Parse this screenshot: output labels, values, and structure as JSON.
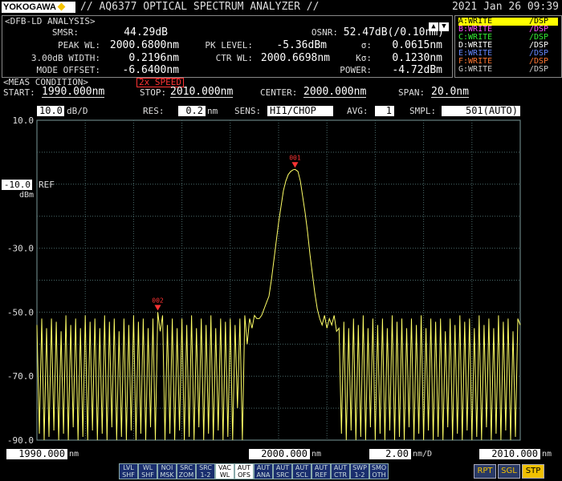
{
  "header": {
    "logo": "YOKOGAWA",
    "title": "// AQ6377 OPTICAL SPECTRUM ANALYZER //",
    "datetime": "2021 Jan 26 09:39"
  },
  "analysis": {
    "title": "<DFB-LD ANALYSIS>",
    "left": [
      {
        "label": "SMSR:",
        "value": "44.29dB"
      },
      {
        "label": "PEAK WL:",
        "value": "2000.6800nm"
      },
      {
        "label": "3.00dB WIDTH:",
        "value": "0.2196nm"
      },
      {
        "label": "MODE OFFSET:",
        "value": "-6.6400nm"
      }
    ],
    "mid": [
      {
        "label": "PK LEVEL:",
        "value": "-5.36dBm"
      },
      {
        "label": "CTR WL:",
        "value": "2000.6698nm"
      }
    ],
    "right": [
      {
        "label": "OSNR:",
        "value": "52.47dB(/0.10nm)"
      },
      {
        "label": "σ:",
        "value": "0.0615nm"
      },
      {
        "label": "Kσ:",
        "value": "0.1230nm"
      },
      {
        "label": "POWER:",
        "value": "-4.72dBm"
      }
    ]
  },
  "traces": [
    {
      "name": "A:WRITE",
      "mode": "/DSP",
      "color": "#ffff00",
      "selected": true
    },
    {
      "name": "B:WRITE",
      "mode": "/DSP",
      "color": "#ff55ff",
      "selected": false
    },
    {
      "name": "C:WRITE",
      "mode": "/DSP",
      "color": "#33ee33",
      "selected": false
    },
    {
      "name": "D:WRITE",
      "mode": "/DSP",
      "color": "#ffffff",
      "selected": false
    },
    {
      "name": "E:WRITE",
      "mode": "/DSP",
      "color": "#6688ff",
      "selected": false
    },
    {
      "name": "F:WRITE",
      "mode": "/DSP",
      "color": "#ff7733",
      "selected": false
    },
    {
      "name": "G:WRITE",
      "mode": "/DSP",
      "color": "#cccccc",
      "selected": false
    }
  ],
  "meas": {
    "title": "<MEAS CONDITION>",
    "speed": "2x SPEED",
    "start_label": "START:",
    "start": "1990.000nm",
    "stop_label": "STOP:",
    "stop": "2010.000nm",
    "center_label": "CENTER:",
    "center": "2000.000nm",
    "span_label": "SPAN:",
    "span": "20.0nm"
  },
  "settings": {
    "scale_value": "10.0",
    "scale_unit": "dB/D",
    "res_label": "RES:",
    "res_value": "0.2",
    "res_unit": "nm",
    "sens_label": "SENS:",
    "sens_value": "HI1/CHOP",
    "avg_label": "AVG:",
    "avg_value": "1",
    "smpl_label": "SMPL:",
    "smpl_value": "501(AUTO)"
  },
  "axis": {
    "ref_value": "-10.0",
    "ref_label": "REF",
    "ref_unit": "dBm",
    "x_start": "1990.000",
    "x_center": "2000.000",
    "x_stop": "2010.000",
    "x_unit": "nm",
    "x_div": "2.00",
    "x_div_unit": "nm/D"
  },
  "softkeys": [
    {
      "top": "LVL",
      "bottom": "SHF",
      "on": false
    },
    {
      "top": "WL",
      "bottom": "SHF",
      "on": false
    },
    {
      "top": "NOI",
      "bottom": "MSK",
      "on": false
    },
    {
      "top": "SRC",
      "bottom": "ZOM",
      "on": false
    },
    {
      "top": "SRC",
      "bottom": "1-2",
      "on": false
    },
    {
      "top": "VAC",
      "bottom": "WL",
      "on": true
    },
    {
      "top": "AUT",
      "bottom": "OFS",
      "on": true
    },
    {
      "top": "AUT",
      "bottom": "ANA",
      "on": false
    },
    {
      "top": "AUT",
      "bottom": "SRC",
      "on": false
    },
    {
      "top": "AUT",
      "bottom": "SCL",
      "on": false
    },
    {
      "top": "AUT",
      "bottom": "REF",
      "on": false
    },
    {
      "top": "AUT",
      "bottom": "CTR",
      "on": false
    },
    {
      "top": "SWP",
      "bottom": "1-2",
      "on": false
    },
    {
      "top": "SMO",
      "bottom": "OTH",
      "on": false
    }
  ],
  "bigkeys": [
    {
      "label": "RPT",
      "active": false
    },
    {
      "label": "SGL",
      "active": false
    },
    {
      "label": "STP",
      "active": true
    }
  ],
  "chart_data": {
    "type": "line",
    "title": "",
    "xlabel": "",
    "ylabel": "",
    "x_unit": "nm",
    "y_unit": "dBm",
    "xlim": [
      1990.0,
      2010.0
    ],
    "ylim": [
      -90.0,
      10.0
    ],
    "y_ticks": [
      "10.0",
      "-10.0",
      "-30.0",
      "-50.0",
      "-70.0",
      "-90.0"
    ],
    "y_tick_values": [
      10,
      -10,
      -30,
      -50,
      -70,
      -90
    ],
    "grid": true,
    "trace_color": "#ffff66",
    "grid_color": "#4a6a6a",
    "series": [
      {
        "points": [
          [
            1990.0,
            -54
          ],
          [
            1990.1,
            -88
          ],
          [
            1990.2,
            -52
          ],
          [
            1990.3,
            -90
          ],
          [
            1990.4,
            -55
          ],
          [
            1990.5,
            -89
          ],
          [
            1990.6,
            -52
          ],
          [
            1990.7,
            -87
          ],
          [
            1990.8,
            -53
          ],
          [
            1990.9,
            -90
          ],
          [
            1991.0,
            -56
          ],
          [
            1991.1,
            -88
          ],
          [
            1991.2,
            -51
          ],
          [
            1991.3,
            -90
          ],
          [
            1991.4,
            -54
          ],
          [
            1991.5,
            -86
          ],
          [
            1991.6,
            -52
          ],
          [
            1991.7,
            -90
          ],
          [
            1991.8,
            -55
          ],
          [
            1991.9,
            -89
          ],
          [
            1992.0,
            -51
          ],
          [
            1992.1,
            -90
          ],
          [
            1992.2,
            -53
          ],
          [
            1992.3,
            -87
          ],
          [
            1992.4,
            -52
          ],
          [
            1992.5,
            -90
          ],
          [
            1992.6,
            -55
          ],
          [
            1992.7,
            -88
          ],
          [
            1992.8,
            -51
          ],
          [
            1992.9,
            -90
          ],
          [
            1993.0,
            -53
          ],
          [
            1993.1,
            -86
          ],
          [
            1993.2,
            -52
          ],
          [
            1993.3,
            -90
          ],
          [
            1993.4,
            -56
          ],
          [
            1993.5,
            -89
          ],
          [
            1993.6,
            -52
          ],
          [
            1993.7,
            -90
          ],
          [
            1993.8,
            -54
          ],
          [
            1993.9,
            -87
          ],
          [
            1994.0,
            -51
          ],
          [
            1994.1,
            -90
          ],
          [
            1994.2,
            -53
          ],
          [
            1994.3,
            -88
          ],
          [
            1994.4,
            -52
          ],
          [
            1994.5,
            -90
          ],
          [
            1994.6,
            -55
          ],
          [
            1994.7,
            -86
          ],
          [
            1994.8,
            -52
          ],
          [
            1994.9,
            -90
          ],
          [
            1995.0,
            -50
          ],
          [
            1995.1,
            -56
          ],
          [
            1995.2,
            -51
          ],
          [
            1995.3,
            -90
          ],
          [
            1995.4,
            -54
          ],
          [
            1995.5,
            -88
          ],
          [
            1995.6,
            -52
          ],
          [
            1995.7,
            -90
          ],
          [
            1995.8,
            -55
          ],
          [
            1995.9,
            -87
          ],
          [
            1996.0,
            -52
          ],
          [
            1996.1,
            -90
          ],
          [
            1996.2,
            -54
          ],
          [
            1996.3,
            -89
          ],
          [
            1996.4,
            -51
          ],
          [
            1996.5,
            -90
          ],
          [
            1996.6,
            -55
          ],
          [
            1996.7,
            -86
          ],
          [
            1996.8,
            -52
          ],
          [
            1996.9,
            -90
          ],
          [
            1997.0,
            -54
          ],
          [
            1997.1,
            -88
          ],
          [
            1997.2,
            -51
          ],
          [
            1997.3,
            -90
          ],
          [
            1997.4,
            -55
          ],
          [
            1997.5,
            -87
          ],
          [
            1997.6,
            -52
          ],
          [
            1997.7,
            -90
          ],
          [
            1997.8,
            -53
          ],
          [
            1997.9,
            -89
          ],
          [
            1998.0,
            -52
          ],
          [
            1998.1,
            -90
          ],
          [
            1998.2,
            -54
          ],
          [
            1998.3,
            -80
          ],
          [
            1998.4,
            -52
          ],
          [
            1998.5,
            -90
          ],
          [
            1998.6,
            -51
          ],
          [
            1998.7,
            -60
          ],
          [
            1998.8,
            -52
          ],
          [
            1998.9,
            -55
          ],
          [
            1999.0,
            -51
          ],
          [
            1999.1,
            -52
          ],
          [
            1999.2,
            -52
          ],
          [
            1999.3,
            -51
          ],
          [
            1999.4,
            -49
          ],
          [
            1999.5,
            -47
          ],
          [
            1999.6,
            -45
          ],
          [
            1999.7,
            -40
          ],
          [
            1999.8,
            -34
          ],
          [
            1999.9,
            -28
          ],
          [
            2000.0,
            -22
          ],
          [
            2000.1,
            -17
          ],
          [
            2000.2,
            -12
          ],
          [
            2000.3,
            -9
          ],
          [
            2000.4,
            -7
          ],
          [
            2000.5,
            -6
          ],
          [
            2000.6,
            -5.5
          ],
          [
            2000.68,
            -5.36
          ],
          [
            2000.8,
            -6
          ],
          [
            2000.9,
            -9
          ],
          [
            2001.0,
            -14
          ],
          [
            2001.1,
            -19
          ],
          [
            2001.2,
            -25
          ],
          [
            2001.3,
            -32
          ],
          [
            2001.4,
            -38
          ],
          [
            2001.5,
            -44
          ],
          [
            2001.6,
            -49
          ],
          [
            2001.7,
            -52
          ],
          [
            2001.8,
            -54
          ],
          [
            2001.9,
            -51
          ],
          [
            2002.0,
            -55
          ],
          [
            2002.1,
            -52
          ],
          [
            2002.2,
            -54
          ],
          [
            2002.3,
            -51
          ],
          [
            2002.4,
            -56
          ],
          [
            2002.5,
            -55
          ],
          [
            2002.6,
            -88
          ],
          [
            2002.7,
            -53
          ],
          [
            2002.8,
            -90
          ],
          [
            2002.9,
            -55
          ],
          [
            2003.0,
            -87
          ],
          [
            2003.1,
            -52
          ],
          [
            2003.2,
            -90
          ],
          [
            2003.3,
            -54
          ],
          [
            2003.4,
            -89
          ],
          [
            2003.5,
            -51
          ],
          [
            2003.6,
            -90
          ],
          [
            2003.7,
            -55
          ],
          [
            2003.8,
            -86
          ],
          [
            2003.9,
            -52
          ],
          [
            2004.0,
            -90
          ],
          [
            2004.1,
            -54
          ],
          [
            2004.2,
            -88
          ],
          [
            2004.3,
            -52
          ],
          [
            2004.4,
            -90
          ],
          [
            2004.5,
            -55
          ],
          [
            2004.6,
            -87
          ],
          [
            2004.7,
            -51
          ],
          [
            2004.8,
            -90
          ],
          [
            2004.9,
            -53
          ],
          [
            2005.0,
            -89
          ],
          [
            2005.1,
            -52
          ],
          [
            2005.2,
            -90
          ],
          [
            2005.3,
            -55
          ],
          [
            2005.4,
            -86
          ],
          [
            2005.5,
            -52
          ],
          [
            2005.6,
            -90
          ],
          [
            2005.7,
            -54
          ],
          [
            2005.8,
            -88
          ],
          [
            2005.9,
            -51
          ],
          [
            2006.0,
            -90
          ],
          [
            2006.1,
            -55
          ],
          [
            2006.2,
            -87
          ],
          [
            2006.3,
            -52
          ],
          [
            2006.4,
            -90
          ],
          [
            2006.5,
            -53
          ],
          [
            2006.6,
            -89
          ],
          [
            2006.7,
            -52
          ],
          [
            2006.8,
            -90
          ],
          [
            2006.9,
            -56
          ],
          [
            2007.0,
            -86
          ],
          [
            2007.1,
            -52
          ],
          [
            2007.2,
            -90
          ],
          [
            2007.3,
            -54
          ],
          [
            2007.4,
            -88
          ],
          [
            2007.5,
            -51
          ],
          [
            2007.6,
            -90
          ],
          [
            2007.7,
            -53
          ],
          [
            2007.8,
            -87
          ],
          [
            2007.9,
            -52
          ],
          [
            2008.0,
            -90
          ],
          [
            2008.1,
            -55
          ],
          [
            2008.2,
            -89
          ],
          [
            2008.3,
            -51
          ],
          [
            2008.4,
            -90
          ],
          [
            2008.5,
            -54
          ],
          [
            2008.6,
            -86
          ],
          [
            2008.7,
            -52
          ],
          [
            2008.8,
            -90
          ],
          [
            2008.9,
            -55
          ],
          [
            2009.0,
            -88
          ],
          [
            2009.1,
            -51
          ],
          [
            2009.2,
            -90
          ],
          [
            2009.3,
            -53
          ],
          [
            2009.4,
            -87
          ],
          [
            2009.5,
            -52
          ],
          [
            2009.6,
            -90
          ],
          [
            2009.7,
            -56
          ],
          [
            2009.8,
            -89
          ],
          [
            2009.9,
            -52
          ],
          [
            2010.0,
            -54
          ]
        ]
      }
    ],
    "markers": [
      {
        "label": "001",
        "x": 2000.68,
        "y": -5.36
      },
      {
        "label": "002",
        "x": 1995.0,
        "y": -50.0
      }
    ]
  }
}
